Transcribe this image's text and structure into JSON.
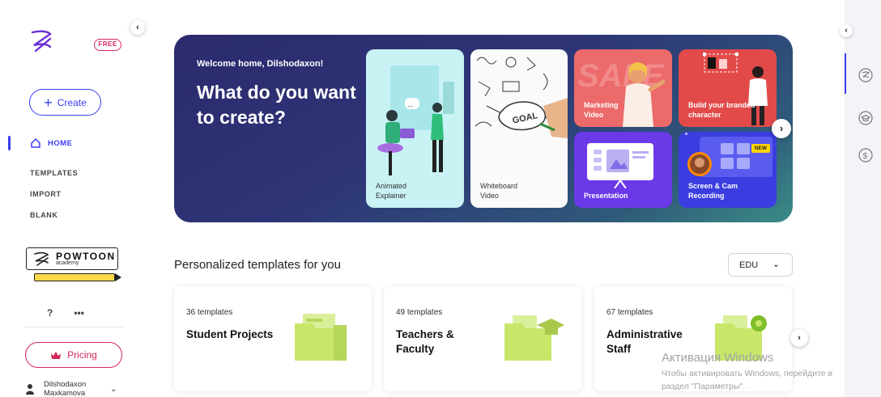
{
  "sidebar": {
    "free_badge": "FREE",
    "create_label": "Create",
    "nav": {
      "home": "HOME",
      "templates": "TEMPLATES",
      "import": "IMPORT",
      "blank": "BLANK"
    },
    "academy": {
      "title": "POWTOON",
      "subtitle": "academy"
    },
    "help_label": "?",
    "more_label": "•••",
    "pricing_label": "Pricing",
    "user": {
      "first_name": "Dilshodaxon",
      "last_name": "Maxkamova"
    }
  },
  "hero": {
    "welcome": "Welcome home, Dilshodaxon!",
    "title": "What do you want to create?",
    "cards": {
      "animated": "Animated Explainer",
      "whiteboard": "Whiteboard Video",
      "whiteboard_sign": "GOAL",
      "marketing": "Marketing Video",
      "marketing_bg": "SALE",
      "branded": "Build your branded character",
      "presentation": "Presentation",
      "screen": "Screen & Cam Recording",
      "new_badge": "NEW"
    }
  },
  "personalized": {
    "title": "Personalized templates for you",
    "filter_value": "EDU",
    "cards": [
      {
        "count": "36 templates",
        "name": "Student Projects"
      },
      {
        "count": "49 templates",
        "name": "Teachers & Faculty"
      },
      {
        "count": "67 templates",
        "name": "Administrative Staff"
      }
    ]
  },
  "watermark": {
    "title": "Активация Windows",
    "line1": "Чтобы активировать Windows, перейдите в",
    "line2": "раздел \"Параметры\"."
  },
  "colors": {
    "accent": "#3a3df0",
    "brand_pink": "#d4285a",
    "folder_green": "#c8e66a"
  },
  "icons": {
    "logo": "powtoon-logo-icon",
    "home": "home-icon",
    "crown": "crown-icon",
    "user": "user-icon",
    "rail": [
      "powtoon-rail-icon",
      "graduation-cap-icon",
      "dollar-rail-icon"
    ]
  }
}
